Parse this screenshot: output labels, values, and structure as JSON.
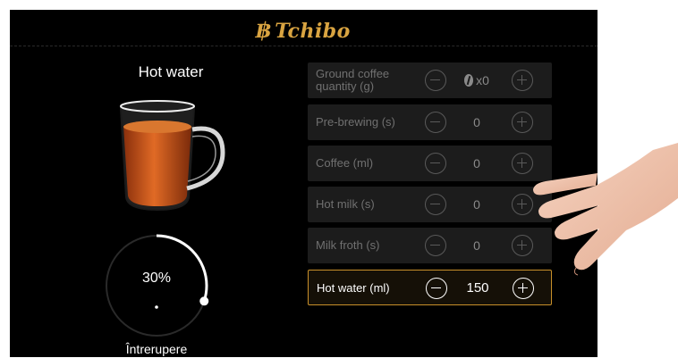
{
  "brand": {
    "name": "Tchibo",
    "accent": "#d9a441"
  },
  "left": {
    "title": "Hot water",
    "progress": {
      "value": 0.3,
      "label": "30%"
    },
    "stop_label": "Întrerupere"
  },
  "settings": [
    {
      "label": "Ground coffee quantity (g)",
      "value": "x0",
      "icon": "coffee-bean-icon",
      "active": false
    },
    {
      "label": "Pre-brewing (s)",
      "value": "0",
      "active": false
    },
    {
      "label": "Coffee (ml)",
      "value": "0",
      "active": false
    },
    {
      "label": "Hot milk (s)",
      "value": "0",
      "active": false
    },
    {
      "label": "Milk froth (s)",
      "value": "0",
      "active": false
    },
    {
      "label": "Hot water (ml)",
      "value": "150",
      "active": true
    }
  ],
  "colors": {
    "active_border": "#c8902a",
    "tea": "#b5481b"
  }
}
